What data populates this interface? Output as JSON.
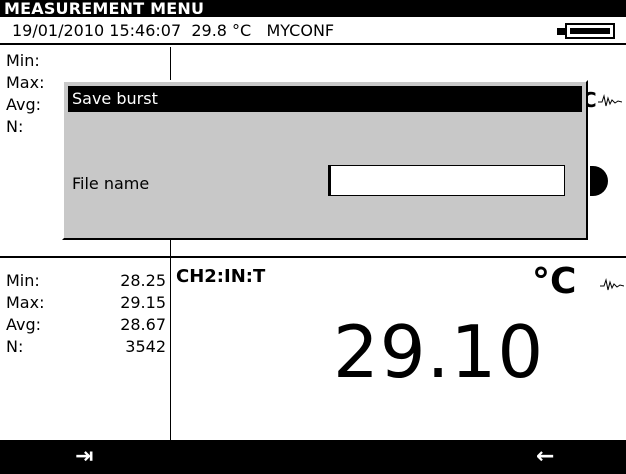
{
  "window": {
    "title": "MEASUREMENT MENU"
  },
  "status": {
    "text": "19/01/2010 15:46:07  29.8 °C   MYCONF"
  },
  "top_panel": {
    "stats_labels": [
      "Min:",
      "Max:",
      "Avg:",
      "N:"
    ],
    "wave_icon": "signal-wave-icon"
  },
  "bottom_panel": {
    "channel": "CH2:IN:T",
    "unit": "°C",
    "value": "29.10",
    "stats": [
      {
        "label": "Min:",
        "value": "28.25"
      },
      {
        "label": "Max:",
        "value": "29.15"
      },
      {
        "label": "Avg:",
        "value": "28.67"
      },
      {
        "label": "N:",
        "value": "3542"
      }
    ]
  },
  "dialog": {
    "title": "Save burst",
    "field_label": "File name",
    "field_value": ""
  },
  "function_keys": {
    "left_symbol": "⇥",
    "right_symbol": "←"
  },
  "colors": {
    "background": "#ffffff",
    "bars": "#000000",
    "dialog": "#c8c8c8"
  }
}
